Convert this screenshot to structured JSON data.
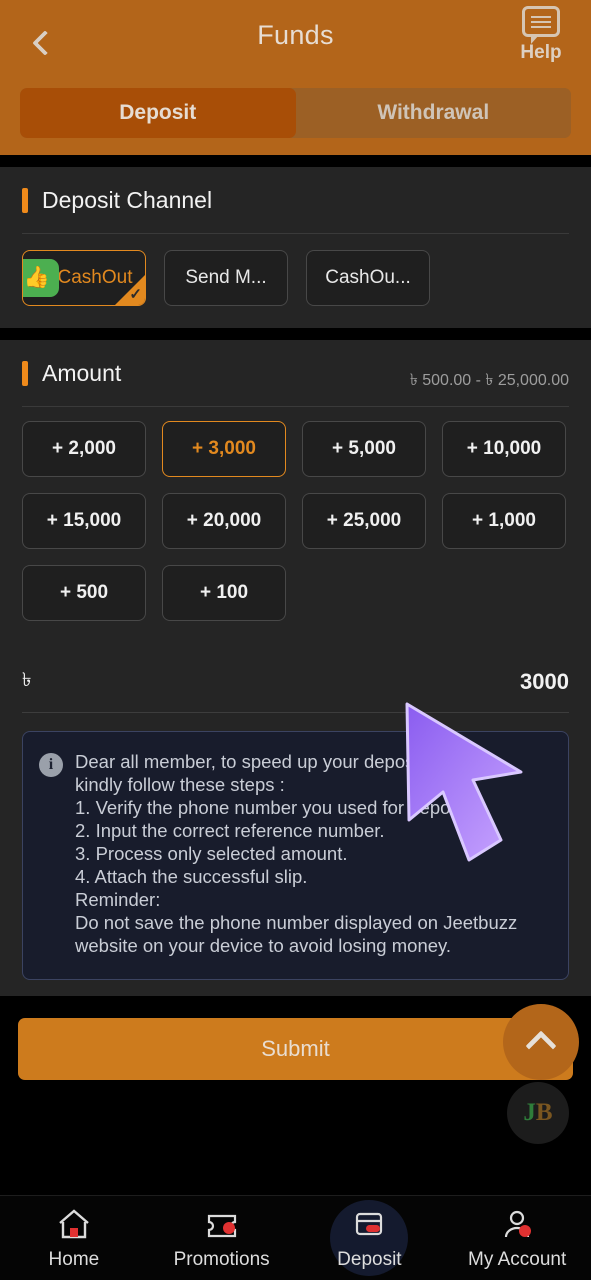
{
  "header": {
    "title": "Funds",
    "back_icon": "chevron-left-icon",
    "help_icon": "speech-bubble-icon",
    "help_label": "Help",
    "background_color": "#b3651a",
    "tabs": [
      {
        "label": "Deposit",
        "active": true
      },
      {
        "label": "Withdrawal",
        "active": false
      }
    ]
  },
  "deposit_channel": {
    "title": "Deposit Channel",
    "accent_color": "#ef8a1b",
    "channels": [
      {
        "label": "CashOut",
        "selected": true,
        "icon": "thumbs-up-icon",
        "icon_color": "#4caf50",
        "check_icon": "check-icon"
      },
      {
        "label": "Send M...",
        "selected": false
      },
      {
        "label": "CashOu...",
        "selected": false
      }
    ]
  },
  "amount": {
    "title": "Amount",
    "range": "৳ 500.00 - ৳ 25,000.00",
    "presets": [
      {
        "label": "+ 2,000",
        "selected": false
      },
      {
        "label": "+ 3,000",
        "selected": true
      },
      {
        "label": "+ 5,000",
        "selected": false
      },
      {
        "label": "+ 10,000",
        "selected": false
      },
      {
        "label": "+ 15,000",
        "selected": false
      },
      {
        "label": "+ 20,000",
        "selected": false
      },
      {
        "label": "+ 25,000",
        "selected": false
      },
      {
        "label": "+ 1,000",
        "selected": false
      },
      {
        "label": "+ 500",
        "selected": false
      },
      {
        "label": "+ 100",
        "selected": false
      }
    ],
    "currency_symbol": "৳",
    "input_value": "3000",
    "input_placeholder": "",
    "selected_color": "#e2891f"
  },
  "notice": {
    "icon": "info-icon",
    "lines": [
      "Dear all member, to speed up your deposit process,",
      "kindly follow these steps :",
      "1. Verify the phone number you used for deposit.",
      "2. Input the correct reference number.",
      "3. Process only selected amount.",
      "4. Attach the successful slip.",
      "Reminder:",
      "Do not save the phone number displayed on Jeetbuzz",
      "website on your device to avoid losing money."
    ]
  },
  "submit": {
    "label": "Submit",
    "color": "#cd7b1d"
  },
  "floating": {
    "scroll_top_icon": "chevron-up-icon",
    "logo_j": "J",
    "logo_b": "B"
  },
  "bottom_nav": [
    {
      "label": "Home",
      "icon": "home-icon",
      "active": false
    },
    {
      "label": "Promotions",
      "icon": "ticket-icon",
      "active": false
    },
    {
      "label": "Deposit",
      "icon": "wallet-card-icon",
      "active": true
    },
    {
      "label": "My Account",
      "icon": "user-icon",
      "active": false
    }
  ]
}
